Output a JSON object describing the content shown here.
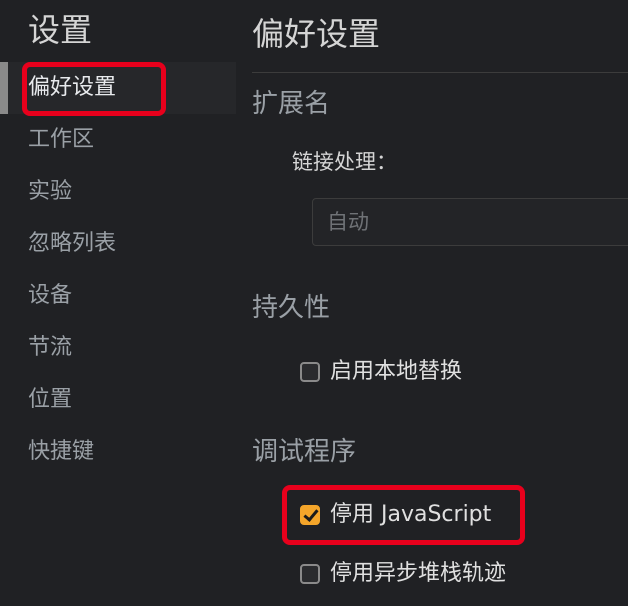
{
  "sidebar": {
    "title": "设置",
    "items": [
      {
        "label": "偏好设置",
        "selected": true
      },
      {
        "label": "工作区",
        "selected": false
      },
      {
        "label": "实验",
        "selected": false
      },
      {
        "label": "忽略列表",
        "selected": false
      },
      {
        "label": "设备",
        "selected": false
      },
      {
        "label": "节流",
        "selected": false
      },
      {
        "label": "位置",
        "selected": false
      },
      {
        "label": "快捷键",
        "selected": false
      }
    ]
  },
  "main": {
    "title": "偏好设置",
    "sections": {
      "extensions": {
        "heading": "扩展名",
        "link_handling_label": "链接处理：",
        "link_handling_value": "自动"
      },
      "persistence": {
        "heading": "持久性",
        "enable_local_overrides": {
          "label": "启用本地替换",
          "checked": false
        }
      },
      "debugger": {
        "heading": "调试程序",
        "disable_javascript": {
          "label": "停用 JavaScript",
          "checked": true
        },
        "disable_async_stack_traces": {
          "label": "停用异步堆栈轨迹",
          "checked": false
        }
      }
    }
  },
  "colors": {
    "background": "#202124",
    "checkbox_checked": "#f4a52a",
    "highlight_box": "#e8001c"
  },
  "icons": {
    "checkmark": "checkmark-icon"
  }
}
